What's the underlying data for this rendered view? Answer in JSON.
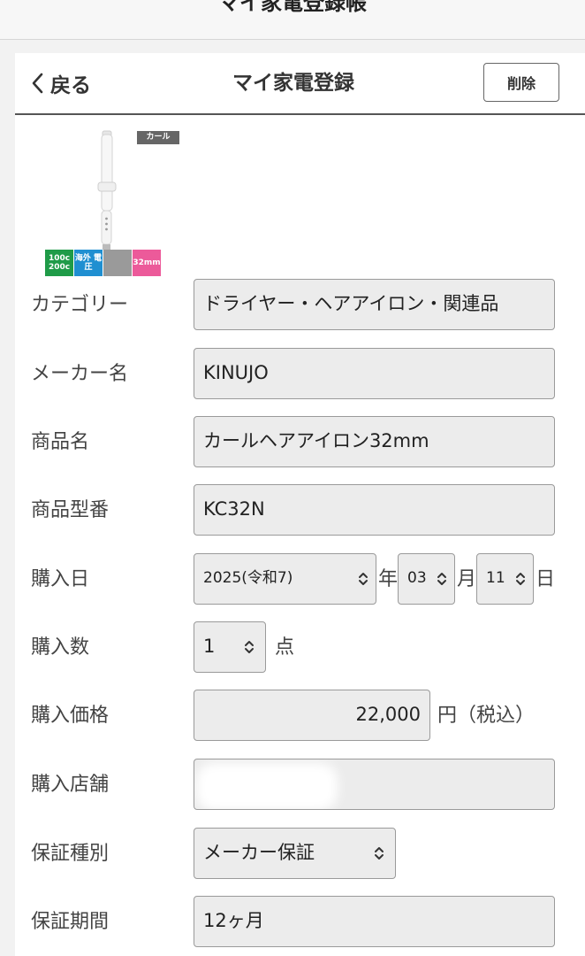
{
  "app": {
    "title": "マイ家電登録帳"
  },
  "nav": {
    "back_label": "戻る",
    "title": "マイ家電登録",
    "delete_label": "削除"
  },
  "product": {
    "category_tag": "カール",
    "badges": [
      "100c 200c",
      "海外 電圧",
      "",
      "32mm"
    ]
  },
  "form": {
    "category": {
      "label": "カテゴリー",
      "value": "ドライヤー・ヘアアイロン・関連品"
    },
    "maker": {
      "label": "メーカー名",
      "value": "KINUJO"
    },
    "product_name": {
      "label": "商品名",
      "value": "カールヘアアイロン32mm"
    },
    "model_number": {
      "label": "商品型番",
      "value": "KC32N"
    },
    "purchase_date": {
      "label": "購入日",
      "year": "2025(令和7)",
      "year_unit": "年",
      "month": "03",
      "month_unit": "月",
      "day": "11",
      "day_unit": "日"
    },
    "quantity": {
      "label": "購入数",
      "value": "1",
      "unit": "点"
    },
    "price": {
      "label": "購入価格",
      "value": "22,000",
      "unit": "円（税込）"
    },
    "store": {
      "label": "購入店舗",
      "value": ""
    },
    "warranty_type": {
      "label": "保証種別",
      "value": "メーカー保証"
    },
    "warranty_period": {
      "label": "保証期間",
      "value": "12ヶ月"
    }
  },
  "colors": {
    "field_bg": "#ececec",
    "field_border": "#9a9a9a",
    "badge_green": "#1f9b48",
    "badge_blue": "#1f8fd1",
    "badge_pink": "#ec5a9a"
  }
}
